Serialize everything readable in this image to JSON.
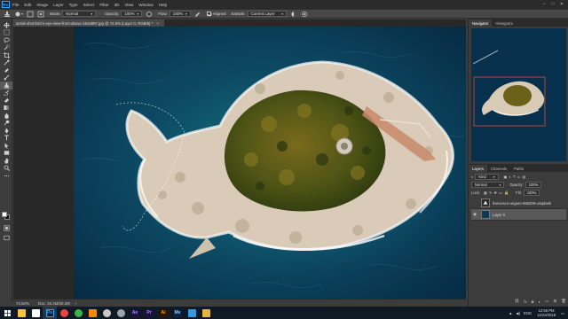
{
  "menu": {
    "app_icon": "Ps",
    "items": [
      "File",
      "Edit",
      "Image",
      "Layer",
      "Type",
      "Select",
      "Filter",
      "3D",
      "View",
      "Window",
      "Help"
    ]
  },
  "options": {
    "mode_label": "Mode:",
    "mode_value": "Normal",
    "opacity_label": "Opacity:",
    "opacity_value": "100%",
    "flow_label": "Flow:",
    "flow_value": "100%",
    "aligned_label": "Aligned",
    "sample_label": "Sample:",
    "sample_value": "Current Layer"
  },
  "document": {
    "tab_title": "aerial-shot-bird-s-eye-view-from-above-1516897.jpg @ 72.5% (Layer 0, RGB/8) *",
    "close": "×",
    "zoom": "72.52%",
    "doc_info": "Doc: 20.2M/20.2M"
  },
  "panels": {
    "nav_tabs": [
      "Navigator",
      "Histogram"
    ],
    "layers_tabs": [
      "Layers",
      "Channels",
      "Paths"
    ],
    "kind_label": "Kind",
    "blend_value": "Normal",
    "opacity_label": "Opacity:",
    "opacity_value": "100%",
    "lock_label": "Lock:",
    "fill_label": "Fill:",
    "fill_value": "100%",
    "layers": [
      {
        "name": "francesco-ungaro-595209-unsplash",
        "visible": false
      },
      {
        "name": "Layer 0",
        "visible": true
      }
    ]
  },
  "taskbar": {
    "icons": [
      {
        "name": "file-explorer-icon",
        "label": "",
        "color": "#f4c542"
      },
      {
        "name": "store-icon",
        "label": "",
        "color": "#ffffff"
      },
      {
        "name": "photoshop-icon",
        "label": "Ps",
        "color": "#31a8ff"
      },
      {
        "name": "chrome-icon",
        "label": "",
        "color": "#e8453c"
      },
      {
        "name": "app-green-icon",
        "label": "",
        "color": "#3ab54a"
      },
      {
        "name": "vlc-icon",
        "label": "",
        "color": "#f08a00"
      },
      {
        "name": "steam-icon",
        "label": "",
        "color": "#c8c8c8"
      },
      {
        "name": "media-icon",
        "label": "",
        "color": "#9aa4ad"
      },
      {
        "name": "after-effects-icon",
        "label": "Ae",
        "color": "#9999ff"
      },
      {
        "name": "premiere-icon",
        "label": "Pr",
        "color": "#9999ff"
      },
      {
        "name": "illustrator-icon",
        "label": "Ai",
        "color": "#ff9a00"
      },
      {
        "name": "media-encoder-icon",
        "label": "Me",
        "color": "#8fc9ff"
      },
      {
        "name": "vscode-icon",
        "label": "",
        "color": "#3a96dd"
      },
      {
        "name": "folder-icon",
        "label": "",
        "color": "#e0b64a"
      }
    ],
    "lang": "ENG",
    "time": "12:56 PM",
    "date": "12/23/2018"
  }
}
